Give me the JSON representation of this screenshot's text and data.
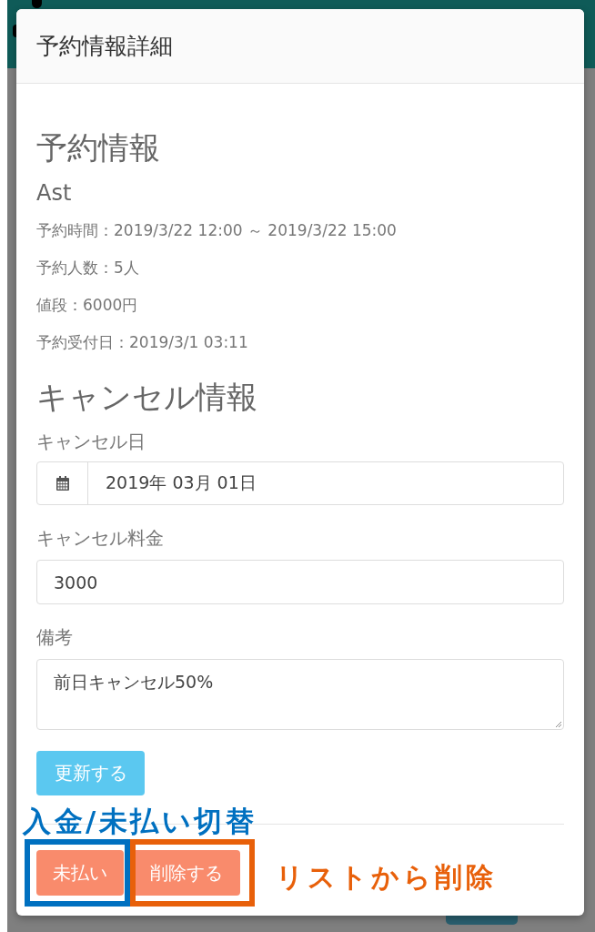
{
  "modal": {
    "title": "予約情報詳細"
  },
  "reservation": {
    "heading": "予約情報",
    "name": "Ast",
    "details": [
      "予約時間：2019/3/22 12:00 ～ 2019/3/22 15:00",
      "予約人数：5人",
      "値段：6000円",
      "予約受付日：2019/3/1 03:11"
    ]
  },
  "cancellation": {
    "heading": "キャンセル情報",
    "fields": [
      {
        "kind": "date",
        "label": "キャンセル日",
        "value": "2019年 03月 01日"
      },
      {
        "kind": "text",
        "label": "キャンセル料金",
        "value": "3000"
      },
      {
        "kind": "textarea",
        "label": "備考",
        "value": "前日キャンセル50%"
      }
    ],
    "submit": "更新する"
  },
  "footer_buttons": [
    {
      "label": "未払い",
      "annotation": {
        "kind": "above",
        "text": "入金/未払い切替",
        "color": "#0070c0"
      }
    },
    {
      "label": "削除する",
      "annotation": {
        "kind": "right",
        "text": "リストから削除",
        "color": "#e8600a"
      }
    }
  ]
}
